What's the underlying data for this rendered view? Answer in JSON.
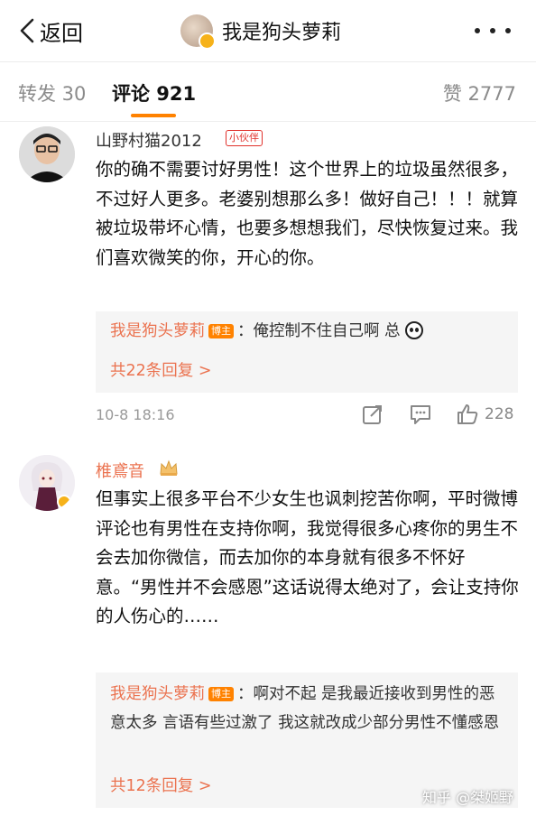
{
  "header": {
    "back_label": "返回",
    "title": "我是狗头萝莉"
  },
  "tabs": {
    "repost": "转发 30",
    "comment": "评论 921",
    "like": "赞 2777"
  },
  "comments": [
    {
      "username": "山野村猫2012",
      "badge": "小伙伴",
      "text": "你的确不需要讨好男性！这个世界上的垃圾虽然很多，不过好人更多。老婆别想那么多！做好自己！！！就算被垃圾带坏心情，也要多想想我们，尽快恢复过来。我们喜欢微笑的你，开心的你。",
      "reply_name": "我是狗头萝莉",
      "reply_badge": "博主",
      "reply_text": "：俺控制不住自己啊 总",
      "reply_count": "共22条回复 >",
      "time": "10-8 18:16",
      "likes": "228"
    },
    {
      "username": "椎鳶音",
      "text": "但事实上很多平台不少女生也讽刺挖苦你啊，平时微博评论也有男性在支持你啊，我觉得很多心疼你的男生不会去加你微信，而去加你的本身就有很多不怀好意。“男性并不会感恩”这话说得太绝对了，会让支持你的人伤心的……",
      "reply_name": "我是狗头萝莉",
      "reply_badge": "博主",
      "reply_text": "：啊对不起 是我最近接收到男性的恶意太多 言语有些过激了 我这就改成少部分男性不懂感恩",
      "reply_count": "共12条回复 >"
    }
  ],
  "watermark": "知乎 @桀姬野",
  "colors": {
    "accent": "#ff8200",
    "link": "#eb7350",
    "partner_badge": "#e0312b"
  }
}
